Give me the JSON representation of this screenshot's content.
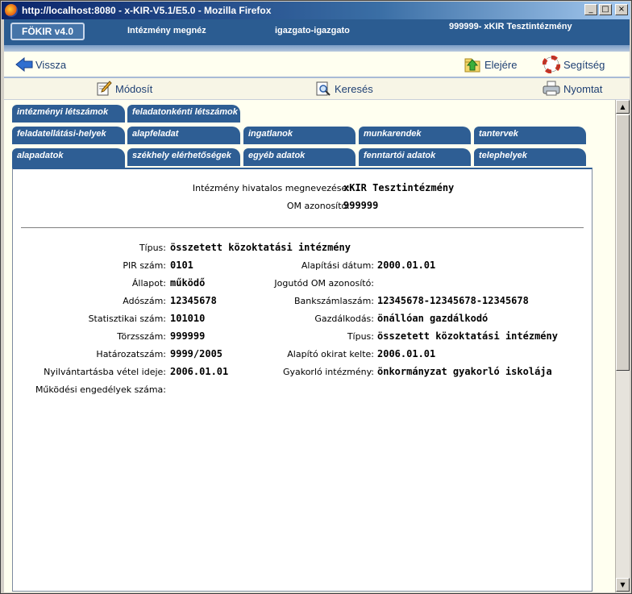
{
  "window": {
    "title": "http://localhost:8080 - x-KIR-V5.1/E5.0 - Mozilla Firefox"
  },
  "header": {
    "logo": "FÖKIR v4.0",
    "page_title": "Intézmény megnéz",
    "user": "igazgato-igazgato",
    "institution": "999999- xKIR Tesztintézmény"
  },
  "nav": {
    "back": "Vissza",
    "top": "Elejére",
    "help": "Segítség"
  },
  "toolbar": {
    "modify": "Módosít",
    "search": "Keresés",
    "print": "Nyomtat"
  },
  "tabs": {
    "row1": [
      "intézményi létszámok",
      "feladatonkénti létszámok"
    ],
    "row2": [
      "feladatellátási-helyek",
      "alapfeladat",
      "ingatlanok",
      "munkarendek",
      "tantervek"
    ],
    "row3": [
      "alapadatok",
      "székhely elérhetőségek",
      "egyéb adatok",
      "fenntartói adatok",
      "telephelyek"
    ]
  },
  "summary": {
    "name_label": "Intézmény hivatalos megnevezése:",
    "name_value": "xKIR Tesztintézmény",
    "om_label": "OM azonosító:",
    "om_value": "999999"
  },
  "fields": {
    "tipus_label": "Típus:",
    "tipus_value": "összetett közoktatási intézmény",
    "pir_label": "PIR szám:",
    "pir_value": "0101",
    "alapitas_label": "Alapítási dátum:",
    "alapitas_value": "2000.01.01",
    "allapot_label": "Állapot:",
    "allapot_value": "működő",
    "jogutod_label": "Jogutód OM azonosító:",
    "jogutod_value": "",
    "adoszam_label": "Adószám:",
    "adoszam_value": "12345678",
    "bank_label": "Bankszámlaszám:",
    "bank_value": "12345678-12345678-12345678",
    "stat_label": "Statisztikai szám:",
    "stat_value": "101010",
    "gazd_label": "Gazdálkodás:",
    "gazd_value": "önállóan gazdálkodó",
    "torzs_label": "Törzsszám:",
    "torzs_value": "999999",
    "tipus2_label": "Típus:",
    "tipus2_value": "összetett közoktatási intézmény",
    "hat_label": "Határozatszám:",
    "hat_value": "9999/2005",
    "okirat_label": "Alapító okirat kelte:",
    "okirat_value": "2006.01.01",
    "nyilv_label": "Nyilvántartásba vétel ideje:",
    "nyilv_value": "2006.01.01",
    "gyak_label": "Gyakorló intézmény:",
    "gyak_value": "önkormányzat gyakorló iskolája",
    "engedely_label": "Működési engedélyek száma:",
    "engedely_value": ""
  }
}
